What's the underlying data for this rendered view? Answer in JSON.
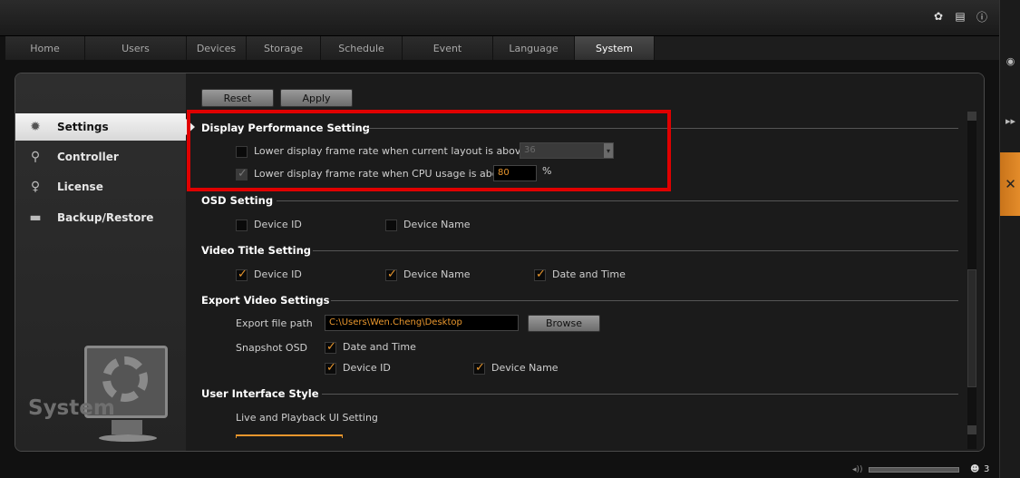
{
  "top_icons": [
    "gear-icon",
    "document-icon",
    "info-icon"
  ],
  "tabs": [
    {
      "label": "Home"
    },
    {
      "label": "Users"
    },
    {
      "label": "Devices"
    },
    {
      "label": "Storage"
    },
    {
      "label": "Schedule"
    },
    {
      "label": "Event"
    },
    {
      "label": "Language"
    },
    {
      "label": "System"
    }
  ],
  "active_tab": "System",
  "sidebar": {
    "items": [
      {
        "label": "Settings",
        "icon": "gear-icon"
      },
      {
        "label": "Controller",
        "icon": "joystick-icon"
      },
      {
        "label": "License",
        "icon": "key-icon"
      },
      {
        "label": "Backup/Restore",
        "icon": "folder-icon"
      }
    ],
    "active": "Settings",
    "footer_label": "System"
  },
  "toolbar": {
    "reset_label": "Reset",
    "apply_label": "Apply"
  },
  "sections": {
    "display_performance": {
      "title": "Display Performance Setting",
      "layout_label": "Lower display frame rate when current layout is above",
      "layout_value": "36",
      "layout_checked": false,
      "cpu_label": "Lower display frame rate when CPU usage is above",
      "cpu_value": "80",
      "cpu_unit": "%",
      "cpu_checked": true
    },
    "osd": {
      "title": "OSD Setting",
      "device_id": "Device ID",
      "device_name": "Device Name"
    },
    "video_title": {
      "title": "Video Title Setting",
      "device_id": "Device ID",
      "device_name": "Device Name",
      "date_time": "Date and Time"
    },
    "export_video": {
      "title": "Export Video Settings",
      "path_label": "Export file path",
      "path_value": "C:\\Users\\Wen.Cheng\\Desktop",
      "browse_label": "Browse",
      "snapshot_label": "Snapshot OSD",
      "date_time": "Date and Time",
      "device_id": "Device ID",
      "device_name": "Device Name"
    },
    "ui_style": {
      "title": "User Interface Style",
      "sub_label": "Live and Playback UI Setting"
    }
  },
  "status": {
    "user_count": "3"
  },
  "colors": {
    "accent": "#e8962d",
    "highlight": "#e00000"
  }
}
